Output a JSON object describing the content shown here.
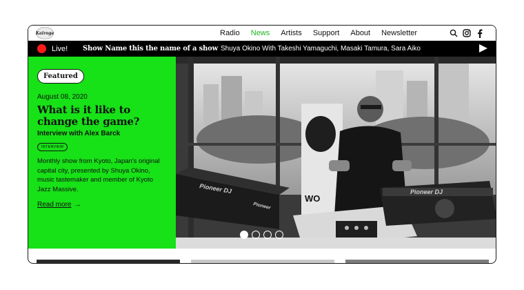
{
  "logo": {
    "text": "Kairoga",
    "icon": "station-logo-icon"
  },
  "nav": {
    "items": [
      {
        "label": "Radio",
        "active": false
      },
      {
        "label": "News",
        "active": true
      },
      {
        "label": "Artists",
        "active": false
      },
      {
        "label": "Support",
        "active": false
      },
      {
        "label": "About",
        "active": false
      },
      {
        "label": "Newsletter",
        "active": false
      }
    ],
    "icons": [
      "search-icon",
      "instagram-icon",
      "facebook-icon"
    ],
    "active_color": "#1fb51f"
  },
  "live": {
    "label": "Live!",
    "show_name": "Show Name this the name of a show",
    "hosts": "Shuya Okino With Takeshi Yamaguchi, Masaki Tamura, Sara Aiko",
    "dot_color": "#ff1a1a",
    "play_icon": "play-icon"
  },
  "feature": {
    "badge": "Featured",
    "date": "August 08, 2020",
    "title": "What is it like to change the game?",
    "subtitle": "Interview with Alex Barck",
    "tag": "INTERVIEW",
    "description": "Monthly show from Kyoto, Japan's original capital city, presented by Shuya Okino, music tastemaker and member of Kyoto Jazz Massive.",
    "read_more": "Read more",
    "bg_color": "#17e117"
  },
  "hero": {
    "equipment_left": "Pioneer DJ",
    "equipment_mid": "Pioneer",
    "equipment_right": "Pioneer DJ",
    "sign_text": "WO",
    "slides": 4,
    "active_slide": 0
  }
}
